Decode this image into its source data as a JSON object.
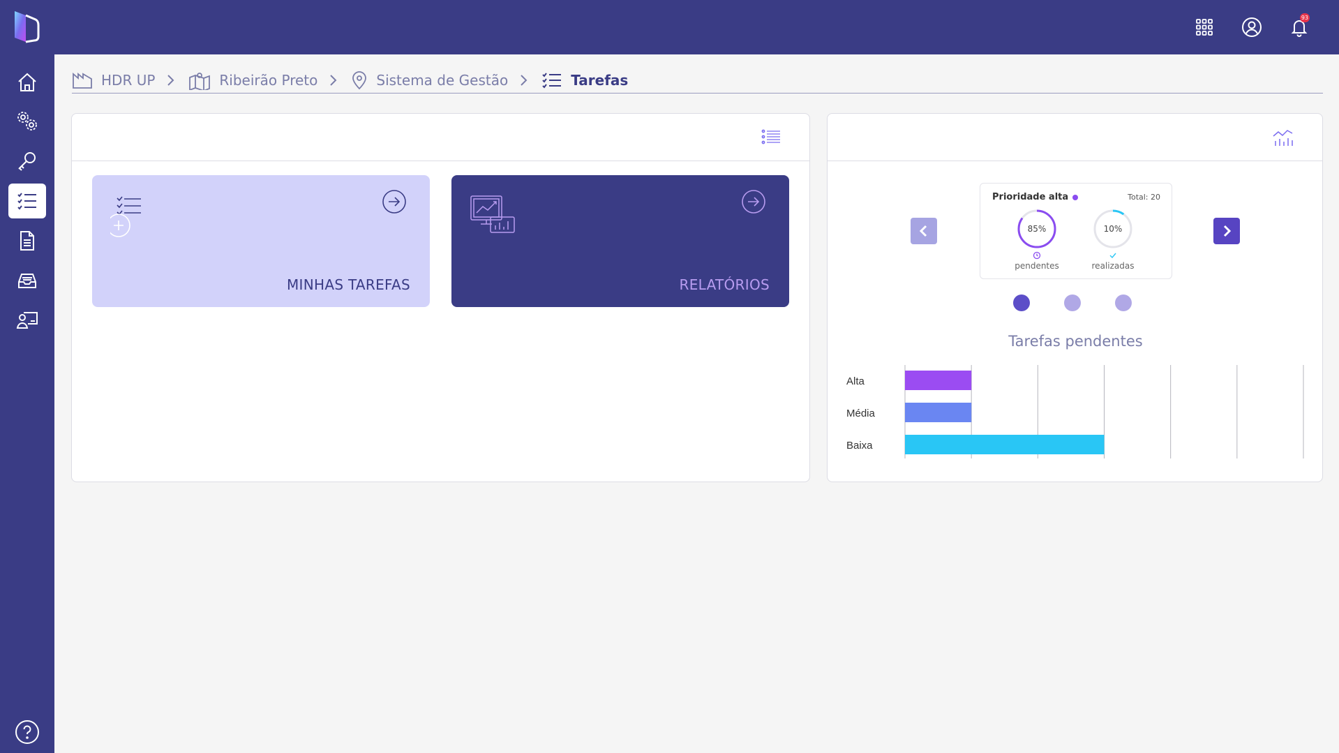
{
  "topbar": {
    "icons": [
      "apps-grid-icon",
      "user-circle-icon",
      "bell-icon"
    ],
    "notification_count": "93"
  },
  "sidebar": {
    "items": [
      "home-icon",
      "settings-gears-icon",
      "key-icon",
      "task-list-icon",
      "document-icon",
      "inbox-icon",
      "user-board-icon"
    ],
    "active_index": 3,
    "help_icon": "help-icon"
  },
  "breadcrumb": [
    {
      "label": "HDR UP",
      "icon": "factory-icon"
    },
    {
      "label": "Ribeirão Preto",
      "icon": "map-icon"
    },
    {
      "label": "Sistema de Gestão",
      "icon": "location-pin-icon"
    },
    {
      "label": "Tarefas",
      "icon": "checklist-icon"
    }
  ],
  "cards": {
    "tasks_label": "MINHAS TAREFAS",
    "reports_label": "RELATÓRIOS"
  },
  "stats": {
    "title": "Prioridade alta",
    "total": "Total: 20",
    "pending_percent": "85%",
    "pending_label": "pendentes",
    "done_percent": "10%",
    "done_label": "realizadas",
    "pending_fraction": 0.85,
    "done_fraction": 0.1
  },
  "carousel": {
    "dot_count": 3,
    "active": 0
  },
  "colors": {
    "primary": "#3a3c85",
    "alta": "#9b4cf2",
    "media": "#6a86f2",
    "baixa": "#29c6f5"
  },
  "chart_data": {
    "type": "bar",
    "orientation": "horizontal",
    "title": "Tarefas pendentes",
    "categories": [
      "Alta",
      "Média",
      "Baixa"
    ],
    "values": [
      1,
      1,
      3
    ],
    "xlim": [
      0,
      6
    ],
    "grid": true
  }
}
